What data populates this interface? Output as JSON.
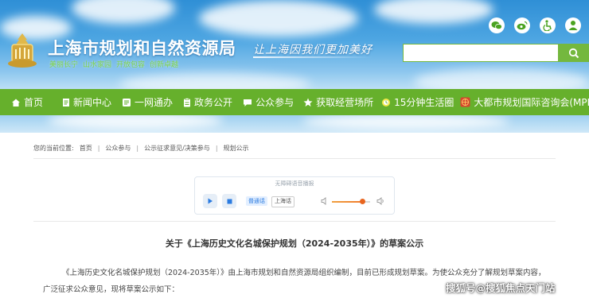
{
  "header": {
    "site_title": "上海市规划和自然资源局",
    "slogans": [
      "美丽长宁",
      "山水家园",
      "开放包容",
      "创新卓越"
    ],
    "motto": "让上海因我们更加美好",
    "top_icons": [
      "wechat-icon",
      "weibo-icon",
      "accessibility-icon",
      "user-icon"
    ],
    "search": {
      "placeholder": "",
      "button_icon": "search-icon"
    },
    "colors": {
      "sky": "#4ea6e2",
      "accent_green": "#74b83e"
    }
  },
  "nav": {
    "items": [
      {
        "label": "首页",
        "icon": "home-icon"
      },
      {
        "label": "新闻中心",
        "icon": "document-icon"
      },
      {
        "label": "一网通办",
        "icon": "grid-icon"
      },
      {
        "label": "政务公开",
        "icon": "clipboard-icon"
      },
      {
        "label": "公众参与",
        "icon": "chat-icon"
      },
      {
        "label": "获取经营场所",
        "icon": "star-icon"
      },
      {
        "label": "15分钟生活圈",
        "icon": "clock-icon"
      },
      {
        "label": "大都市规划国际咨询会(MPIC)",
        "icon": "globe-badge-icon"
      }
    ],
    "background": "#66b02c"
  },
  "breadcrumb": {
    "prefix": "您的当前位置:",
    "items": [
      "首页",
      "公众参与",
      "公示征求意见/决策参与",
      "规划公示"
    ]
  },
  "player": {
    "title": "无障碍语音播报",
    "mode_active": "普通话",
    "mode_inactive": "上海话",
    "volume_level": 0.8
  },
  "article": {
    "title": "关于《上海历史文化名城保护规划（2024-2035年）》的草案公示",
    "body": "《上海历史文化名城保护规划（2024-2035年）》由上海市规划和自然资源局组织编制，目前已形成规划草案。为使公众充分了解规划草案内容，广泛征求公众意见，现将草案公示如下："
  },
  "watermark": "搜狐号@搜狐焦点天门站"
}
